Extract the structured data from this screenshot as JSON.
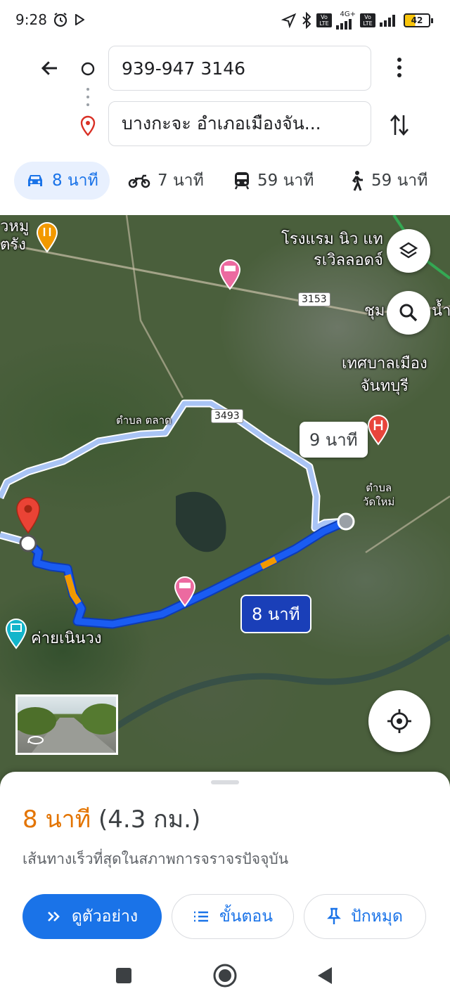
{
  "status": {
    "time": "9:28",
    "network_label": "4G+",
    "volte": "Vo LTE",
    "battery": "42"
  },
  "directions": {
    "origin": "939-947 3146",
    "destination": "บางกะจะ อำเภอเมืองจัน...",
    "modes": [
      {
        "icon": "car-icon",
        "label": "8 นาที",
        "active": true
      },
      {
        "icon": "motorcycle-icon",
        "label": "7 นาที"
      },
      {
        "icon": "transit-icon",
        "label": "59 นาที"
      },
      {
        "icon": "walk-icon",
        "label": "59 นาที"
      }
    ]
  },
  "map": {
    "labels": {
      "poi_topleft": "วหมู\nตรัง",
      "hotel_name": "โรงแรม นิว แท\nรเวิลลอดจ์",
      "route_3153": "3153",
      "community": "ชุม",
      "community_right": "น้ำ",
      "municipality": "เทศบาลเมือง\nจันทบุรี",
      "tambon_talat": "ตำบล ตลาด",
      "route_3493": "3493",
      "tambon_wat_mai": "ตำบล\nวัดใหม่",
      "camp": "ค่ายเนินวง"
    },
    "alt_route_time": "9 นาที",
    "main_route_time": "8 นาที",
    "colors": {
      "route": "#1a5cf2",
      "alt_route": "#a9c4f5",
      "traffic_slow": "#f29900",
      "transit_green": "#34a853"
    }
  },
  "sheet": {
    "duration": "8 นาที",
    "distance": "(4.3 กม.)",
    "description": "เส้นทางเร็วที่สุดในสภาพการจราจรปัจจุบัน",
    "buttons": {
      "preview": "ดูตัวอย่าง",
      "steps": "ขั้นตอน",
      "pin": "ปักหมุด"
    },
    "accent_color": "#e37400",
    "primary_color": "#1a73e8"
  }
}
